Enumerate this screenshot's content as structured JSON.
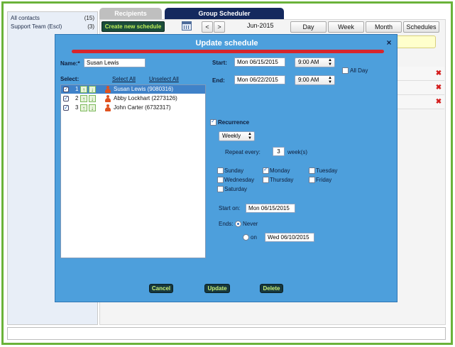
{
  "contacts": [
    {
      "name": "All contacts",
      "count": "(15)"
    },
    {
      "name": "Support Team (Escl)",
      "count": "(3)"
    }
  ],
  "tabs": {
    "recipients": "Recipients",
    "scheduler": "Group Scheduler"
  },
  "toolbar": {
    "create_label": "Create new schedule",
    "prev_label": "<",
    "next_label": ">",
    "month": "Jun-2015",
    "views": [
      "Day",
      "Week",
      "Month",
      "Schedules"
    ]
  },
  "modal": {
    "title": "Update schedule",
    "close": "×",
    "name_label": "Name:*",
    "name_value": "Susan Lewis",
    "select_label": "Select:",
    "select_all": "Select All",
    "unselect_all": "Unselect All",
    "recipients": [
      {
        "num": "1",
        "name": "Susan Lewis (9080316)",
        "selected": true
      },
      {
        "num": "2",
        "name": "Abby Lockhart (2273126)",
        "selected": false
      },
      {
        "num": "3",
        "name": "John Carter (6732317)",
        "selected": false
      }
    ],
    "start_label": "Start:",
    "start_date": "Mon 06/15/2015",
    "start_time": "9:00 AM",
    "end_label": "End:",
    "end_date": "Mon 06/22/2015",
    "end_time": "9:00 AM",
    "all_day": "All Day",
    "recurrence": "Recurrence",
    "frequency": "Weekly",
    "repeat_every": "Repeat every:",
    "repeat_value": "3",
    "repeat_unit": "week(s)",
    "days": {
      "sunday": "Sunday",
      "monday": "Monday",
      "tuesday": "Tuesday",
      "wednesday": "Wednesday",
      "thursday": "Thursday",
      "friday": "Friday",
      "saturday": "Saturday"
    },
    "start_on_label": "Start on:",
    "start_on_value": "Mon 06/15/2015",
    "ends_label": "Ends:",
    "never": "Never",
    "on": "on",
    "ends_on_value": "Wed 06/10/2015",
    "cancel": "Cancel",
    "update": "Update",
    "delete": "Delete"
  },
  "icons": {
    "close": "close-icon",
    "calendar": "calendar-icon",
    "delete_row": "delete-icon",
    "move_up": "arrow-up-icon",
    "move_down": "arrow-down-icon",
    "person": "person-icon"
  },
  "colors": {
    "modal_bg": "#4d9fdc",
    "header_tab": "#14295e",
    "create_button": "#1b4c3b",
    "frame_border": "#6bb33a",
    "error_bar": "#d7262c"
  }
}
